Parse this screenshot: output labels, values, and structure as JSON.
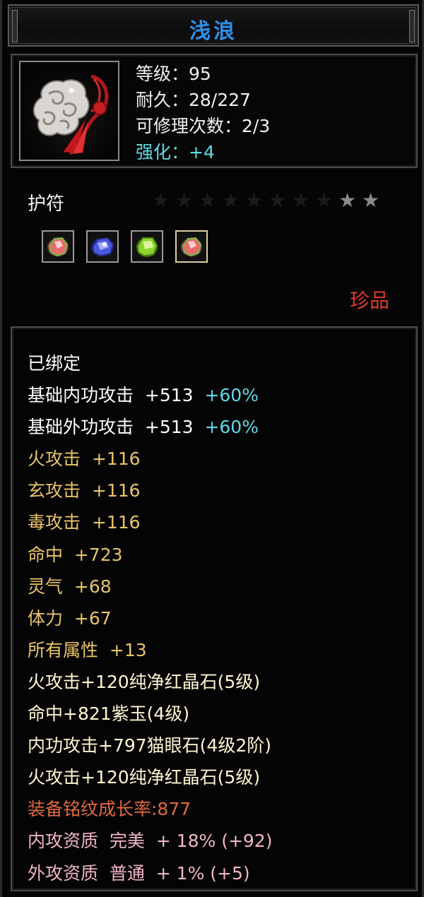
{
  "item": {
    "name": "浅浪",
    "level": "等级：95",
    "durability": "耐久：28/227",
    "repairs": "可修理次数：2/3",
    "enhance": "强化：+4",
    "type": "护符",
    "rarity": "珍品",
    "stars_filled": 2,
    "stars_total": 10,
    "icon": "amulet-icon"
  },
  "gems": [
    {
      "icon": "red-crystal-gem-icon",
      "color": "#e86a6a"
    },
    {
      "icon": "purple-jade-gem-icon",
      "color": "#4a5ae0"
    },
    {
      "icon": "cats-eye-gem-icon",
      "color": "#8ed62e"
    },
    {
      "icon": "red-crystal-gem-icon",
      "color": "#e86a6a"
    }
  ],
  "attributes": {
    "bound": "已绑定",
    "base_inner_label": "基础内功攻击  +513  ",
    "base_inner_pct": "+60%",
    "base_outer_label": "基础外功攻击  +513  ",
    "base_outer_pct": "+60%",
    "fire": "火攻击  +116",
    "mystic": "玄攻击  +116",
    "poison": "毒攻击  +116",
    "hit": "命中  +723",
    "spirit": "灵气  +68",
    "stamina": "体力  +67",
    "all_attr": "所有属性  +13",
    "gem1": "火攻击+120纯净红晶石(5级)",
    "gem2": "命中+821紫玉(4级)",
    "gem3": "内功攻击+797猫眼石(4级2阶)",
    "gem4": "火攻击+120纯净红晶石(5级)",
    "growth": "装备铭纹成长率:877",
    "inner_quality": "内攻资质  完美  + 18% (+92)",
    "outer_quality": "外攻资质  普通  + 1% (+5)"
  },
  "colors": {
    "title": "#2f8fe8",
    "enhance": "#5fd9e6",
    "rarity": "#e03a2a",
    "attribute": "#e8c36a",
    "gem_line": "#fff6d2",
    "growth": "#e0693e",
    "quality": "#f2b5c8"
  }
}
